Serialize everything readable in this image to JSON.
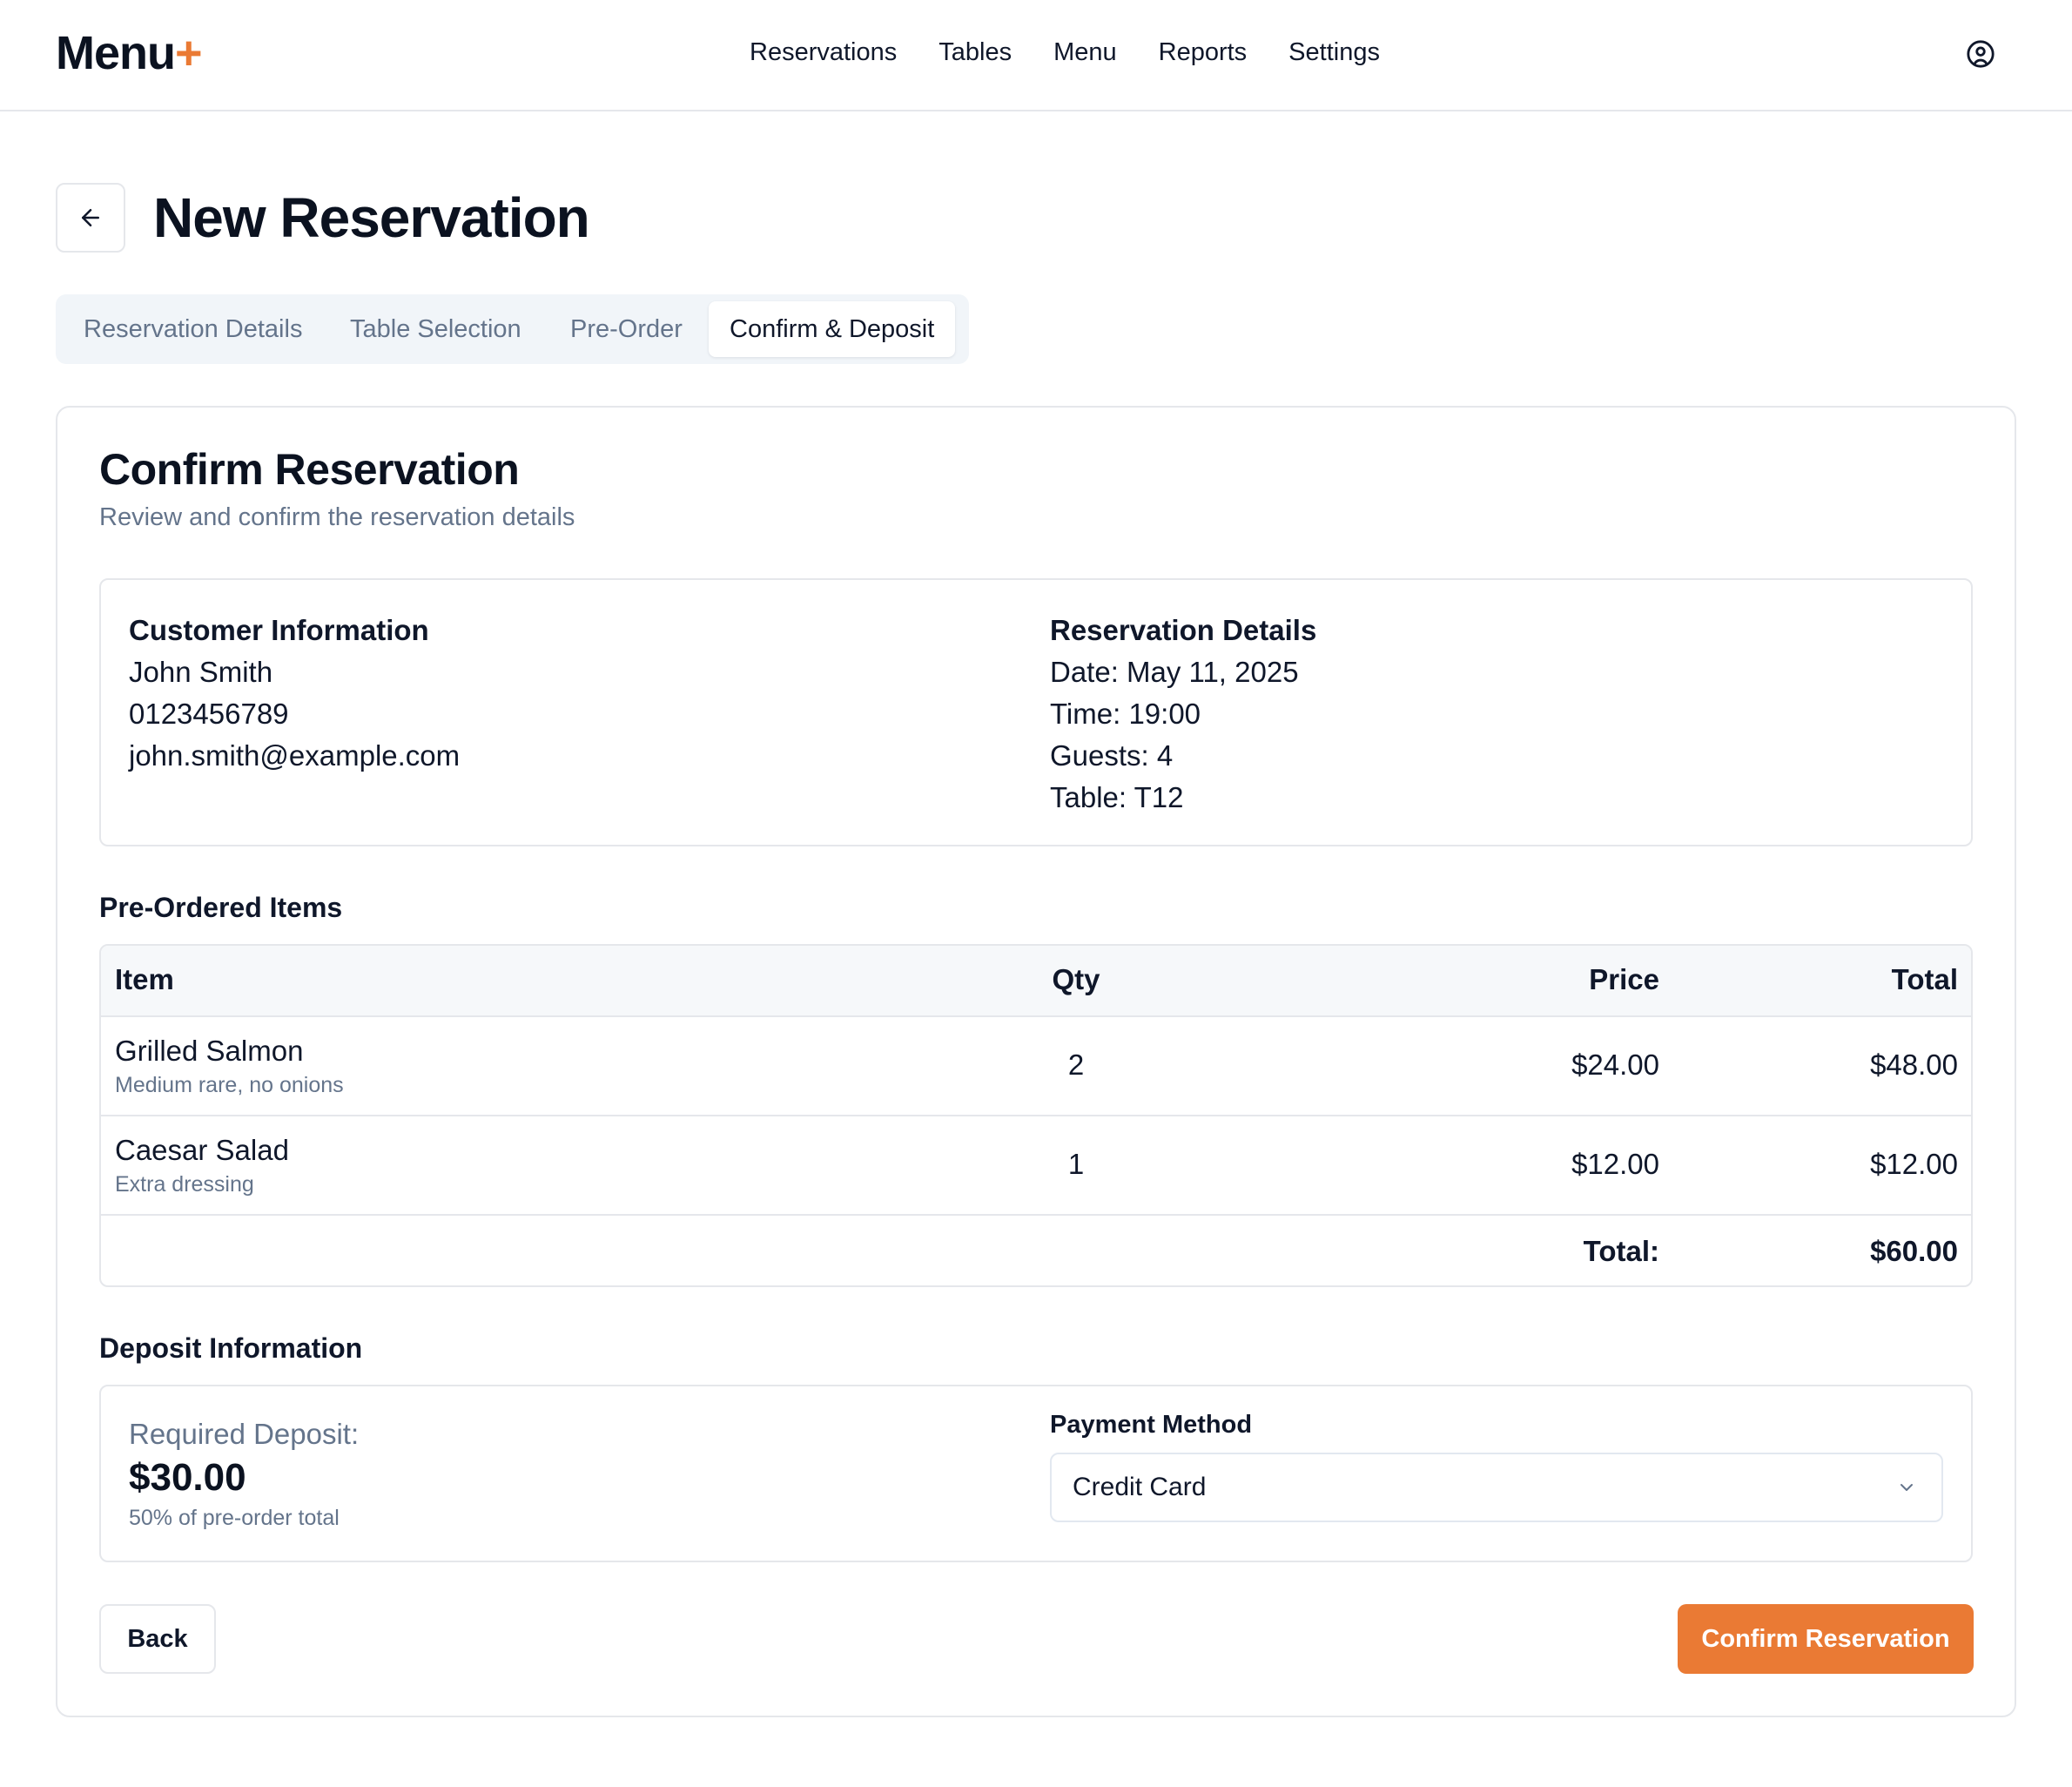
{
  "brand": {
    "name": "Menu",
    "plus": "+",
    "accent_color": "#ea7a34"
  },
  "nav": {
    "items": [
      "Reservations",
      "Tables",
      "Menu",
      "Reports",
      "Settings"
    ],
    "user_icon": "user-circle-icon"
  },
  "page": {
    "title": "New Reservation",
    "back_icon": "arrow-left-icon"
  },
  "steps": {
    "items": [
      "Reservation Details",
      "Table Selection",
      "Pre-Order",
      "Confirm & Deposit"
    ],
    "active": "Confirm & Deposit"
  },
  "confirm": {
    "title": "Confirm Reservation",
    "subtitle": "Review and confirm the reservation details"
  },
  "customer": {
    "heading": "Customer Information",
    "name": "John Smith",
    "phone": "0123456789",
    "email": "john.smith@example.com"
  },
  "reservation": {
    "heading": "Reservation Details",
    "date": "Date: May 11, 2025",
    "time": "Time: 19:00",
    "guests": "Guests: 4",
    "table": "Table: T12"
  },
  "preorder": {
    "heading": "Pre-Ordered Items",
    "columns": {
      "item": "Item",
      "qty": "Qty",
      "price": "Price",
      "total": "Total"
    },
    "rows": [
      {
        "name": "Grilled Salmon",
        "note": "Medium rare, no onions",
        "qty": "2",
        "price": "$24.00",
        "total": "$48.00"
      },
      {
        "name": "Caesar Salad",
        "note": "Extra dressing",
        "qty": "1",
        "price": "$12.00",
        "total": "$12.00"
      }
    ],
    "total_label": "Total:",
    "total_value": "$60.00"
  },
  "deposit": {
    "heading": "Deposit Information",
    "required_label": "Required Deposit:",
    "amount": "$30.00",
    "note": "50% of pre-order total",
    "payment_label": "Payment Method",
    "payment_value": "Credit Card",
    "payment_icon": "chevron-down-icon"
  },
  "actions": {
    "back": "Back",
    "confirm": "Confirm Reservation"
  }
}
